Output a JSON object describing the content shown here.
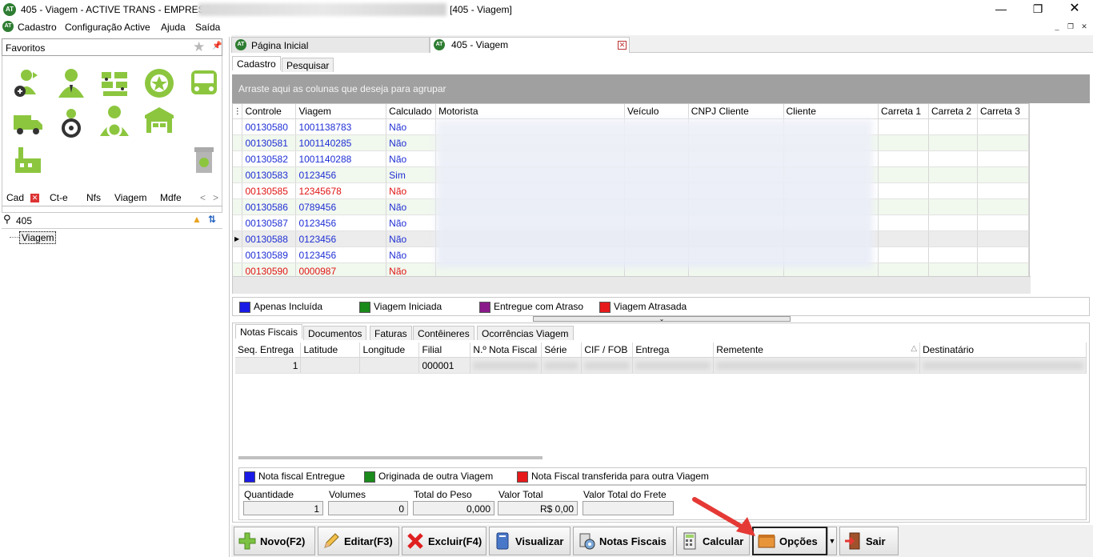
{
  "window": {
    "title_prefix": "405 - Viagem - ACTIVE TRANS - EMPRESA:",
    "title_suffix": "[405 - Viagem]",
    "logo": "AT"
  },
  "menu": [
    "Cadastro",
    "Configuração Active",
    "Ajuda",
    "Saída"
  ],
  "left": {
    "favorites_label": "Favoritos",
    "tabs": [
      "Cad",
      "Ct-e",
      "Nfs",
      "Viagem",
      "Mdfe"
    ],
    "search_value": "405",
    "tree_item": "Viagem"
  },
  "doc_tabs": [
    "Página Inicial",
    "405 - Viagem"
  ],
  "inner_tabs": [
    "Cadastro",
    "Pesquisar"
  ],
  "group_hint": "Arraste aqui as colunas que deseja para agrupar",
  "grid": {
    "columns": [
      "Controle",
      "Viagem",
      "Calculado",
      "Motorista",
      "Veículo",
      "CNPJ Cliente",
      "Cliente",
      "Carreta 1",
      "Carreta 2",
      "Carreta 3"
    ],
    "rows": [
      {
        "controle": "00130580",
        "viagem": "1001138783",
        "calc": "Não",
        "color": "blue"
      },
      {
        "controle": "00130581",
        "viagem": "1001140285",
        "calc": "Não",
        "color": "blue"
      },
      {
        "controle": "00130582",
        "viagem": "1001140288",
        "calc": "Não",
        "color": "blue"
      },
      {
        "controle": "00130583",
        "viagem": "0123456",
        "calc": "Sim",
        "color": "blue"
      },
      {
        "controle": "00130585",
        "viagem": "12345678",
        "calc": "Não",
        "color": "red"
      },
      {
        "controle": "00130586",
        "viagem": "0789456",
        "calc": "Não",
        "color": "blue"
      },
      {
        "controle": "00130587",
        "viagem": "0123456",
        "calc": "Não",
        "color": "blue"
      },
      {
        "controle": "00130588",
        "viagem": "0123456",
        "calc": "Não",
        "color": "blue"
      },
      {
        "controle": "00130589",
        "viagem": "0123456",
        "calc": "Não",
        "color": "blue"
      },
      {
        "controle": "00130590",
        "viagem": "0000987",
        "calc": "Não",
        "color": "red"
      }
    ]
  },
  "legend1": [
    {
      "label": "Apenas Incluída",
      "color": "#1a1ae6"
    },
    {
      "label": "Viagem Iniciada",
      "color": "#1a8a1a"
    },
    {
      "label": "Entregue com Atraso",
      "color": "#8a1a8a"
    },
    {
      "label": "Viagem Atrasada",
      "color": "#e61a1a"
    }
  ],
  "bottom_tabs": [
    "Notas Fiscais",
    "Documentos",
    "Faturas",
    "Contêineres",
    "Ocorrências Viagem"
  ],
  "nf_grid": {
    "columns": [
      "Seq. Entrega",
      "Latitude",
      "Longitude",
      "Filial",
      "N.º Nota Fiscal",
      "Série",
      "CIF / FOB",
      "Entrega",
      "Remetente",
      "Destinatário"
    ],
    "row": {
      "seq": "1",
      "filial": "000001"
    }
  },
  "legend2": [
    {
      "label": "Nota fiscal Entregue",
      "color": "#1a1ae6"
    },
    {
      "label": "Originada de outra Viagem",
      "color": "#1a8a1a"
    },
    {
      "label": "Nota Fiscal transferida para outra Viagem",
      "color": "#e61a1a"
    }
  ],
  "totals": {
    "quantidade_label": "Quantidade",
    "quantidade": "1",
    "volumes_label": "Volumes",
    "volumes": "0",
    "peso_label": "Total do Peso",
    "peso": "0,000",
    "valor_label": "Valor Total",
    "valor": "R$ 0,00",
    "frete_label": "Valor Total do Frete",
    "frete": ""
  },
  "toolbar": {
    "novo": "Novo(F2)",
    "editar": "Editar(F3)",
    "excluir": "Excluir(F4)",
    "visualizar": "Visualizar",
    "notas": "Notas Fiscais",
    "calcular": "Calcular",
    "opcoes": "Opções",
    "sair": "Sair"
  },
  "colors": {
    "brand_green": "#8cc63f",
    "arrow_red": "#e53935",
    "group_bar": "#a0a0a0"
  }
}
